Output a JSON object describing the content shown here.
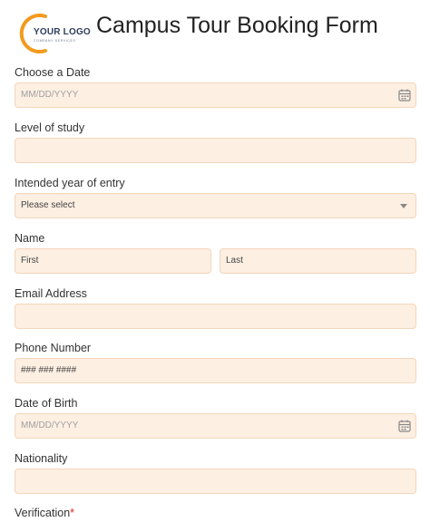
{
  "logo": {
    "text": "YOUR LOGO",
    "subtext": "COMPANY SERVICES"
  },
  "form": {
    "title": "Campus Tour Booking Form",
    "date_label": "Choose a Date",
    "date_placeholder": "MM/DD/YYYY",
    "level_label": "Level of study",
    "intended_year_label": "Intended year of entry",
    "intended_year_value": "Please select",
    "name_label": "Name",
    "first_placeholder": "First",
    "last_placeholder": "Last",
    "email_label": "Email Address",
    "phone_label": "Phone Number",
    "phone_placeholder": "### ### ####",
    "dob_label": "Date of Birth",
    "dob_placeholder": "MM/DD/YYYY",
    "nationality_label": "Nationality",
    "verification_label": "Verification",
    "required_marker": "*"
  },
  "colors": {
    "field_bg": "#fdefe2",
    "field_border": "#f3d6bb",
    "logo_accent": "#f39a1e",
    "required": "#d0311b"
  }
}
